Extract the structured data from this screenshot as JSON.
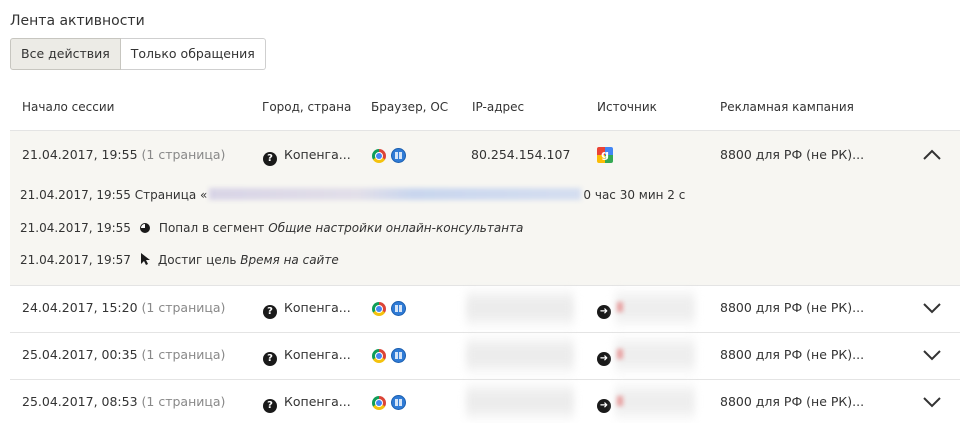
{
  "page": {
    "title": "Лента активности"
  },
  "tabs": [
    {
      "label": "Все действия",
      "active": true
    },
    {
      "label": "Только обращения",
      "active": false
    }
  ],
  "columns": {
    "session_start": "Начало сессии",
    "city": "Город, страна",
    "browser": "Браузер, ОС",
    "ip": "IP-адрес",
    "source": "Источник",
    "campaign": "Рекламная кампания"
  },
  "icons": {
    "city": "question-circle-icon",
    "browser": "chrome-icon",
    "os": "windows-icon",
    "source_google": "google-icon",
    "source_direct": "arrow-right-circle-icon",
    "segment": "pie-chart-icon",
    "goal": "cursor-icon"
  },
  "sessions": [
    {
      "start": "21.04.2017, 19:55",
      "pages": "(1 страница)",
      "city": "Копенга...",
      "ip": "80.254.154.107",
      "campaign": "8800 для РФ (не РК)...",
      "expanded": true,
      "details": {
        "page_line_prefix": "21.04.2017, 19:55 Страница «",
        "page_line_suffix": "0 час 30 мин 2 с",
        "events": [
          {
            "time": "21.04.2017, 19:55",
            "action": "Попал в сегмент",
            "target": "Общие настройки онлайн-консультанта"
          },
          {
            "time": "21.04.2017, 19:57",
            "action": "Достиг цель",
            "target": "Время на сайте"
          }
        ]
      }
    },
    {
      "start": "24.04.2017, 15:20",
      "pages": "(1 страница)",
      "city": "Копенга...",
      "campaign": "8800 для РФ (не РК)...",
      "expanded": false
    },
    {
      "start": "25.04.2017, 00:35",
      "pages": "(1 страница)",
      "city": "Копенга...",
      "campaign": "8800 для РФ (не РК)...",
      "expanded": false
    },
    {
      "start": "25.04.2017, 08:53",
      "pages": "(1 страница)",
      "city": "Копенга...",
      "campaign": "8800 для РФ (не РК)...",
      "expanded": false
    }
  ]
}
